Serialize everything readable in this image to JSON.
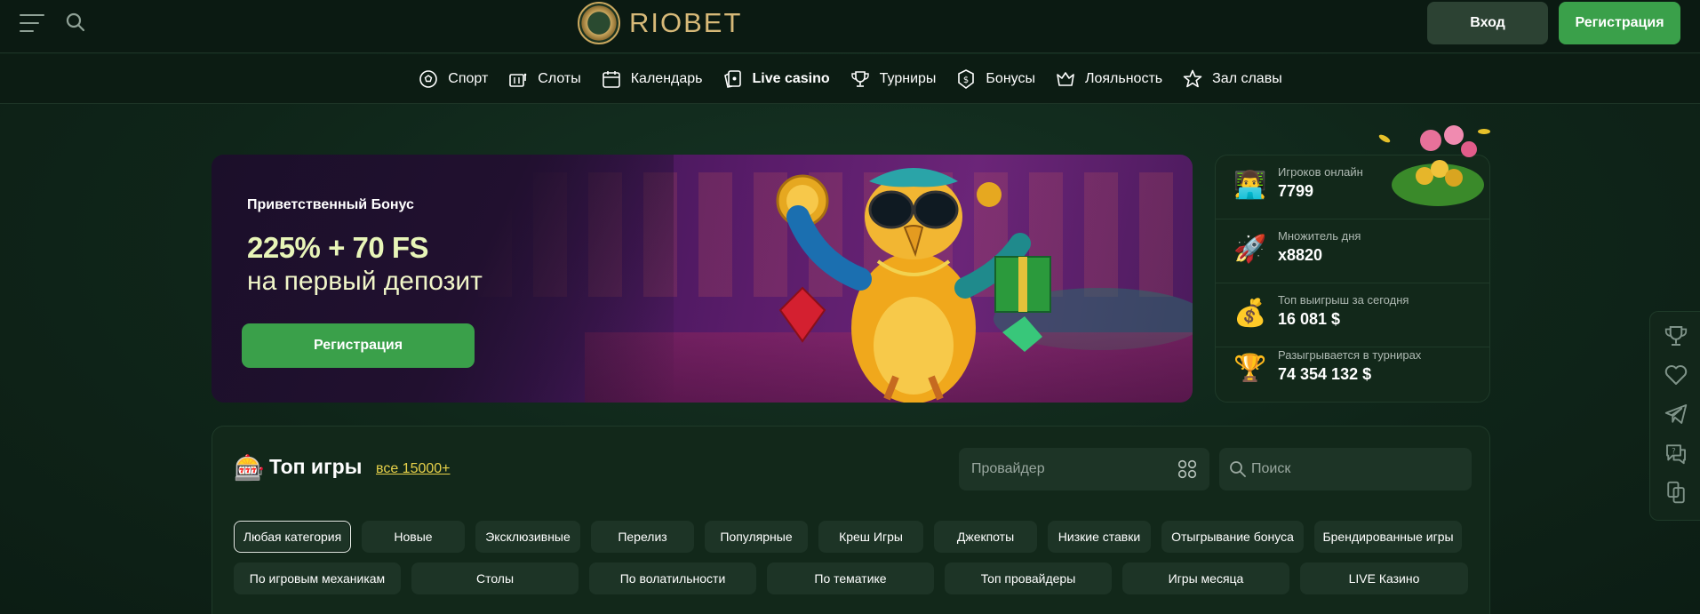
{
  "header": {
    "logo_text": "RIOBET",
    "login_label": "Вход",
    "register_label": "Регистрация"
  },
  "nav": {
    "items": [
      {
        "label": "Спорт",
        "icon": "soccer-ball-icon"
      },
      {
        "label": "Слоты",
        "icon": "slot-machine-icon"
      },
      {
        "label": "Календарь",
        "icon": "calendar-icon"
      },
      {
        "label": "Live casino",
        "icon": "cards-icon"
      },
      {
        "label": "Турниры",
        "icon": "trophy-icon"
      },
      {
        "label": "Бонусы",
        "icon": "coin-icon"
      },
      {
        "label": "Лояльность",
        "icon": "crown-icon"
      },
      {
        "label": "Зал славы",
        "icon": "star-icon"
      }
    ]
  },
  "hero": {
    "subtitle": "Приветственный Бонус",
    "title": "225% + 70 FS",
    "title2": "на первый депозит",
    "button_label": "Регистрация"
  },
  "stats": [
    {
      "label": "Игроков онлайн",
      "value": "7799",
      "icon": "player-icon"
    },
    {
      "label": "Множитель дня",
      "value": "x8820",
      "icon": "rocket-icon"
    },
    {
      "label": "Топ выигрыш за сегодня",
      "value": "16 081 $",
      "icon": "money-bag-icon"
    },
    {
      "label": "Разыгрывается в турнирах",
      "value": "74 354 132 $",
      "icon": "trophy-icon"
    }
  ],
  "side_toolbar": [
    "trophy-icon",
    "heart-icon",
    "telegram-icon",
    "support-chat-icon",
    "app-icon"
  ],
  "games": {
    "title": "Топ игры",
    "all_link": "все 15000+",
    "provider_placeholder": "Провайдер",
    "search_placeholder": "Поиск",
    "categories_row1": [
      "Любая категория",
      "Новые",
      "Эксклюзивные",
      "Перелиз",
      "Популярные",
      "Креш Игры",
      "Джекпоты",
      "Низкие ставки",
      "Отыгрывание бонуса",
      "Брендированные игры"
    ],
    "categories_row2": [
      "По игровым механикам",
      "Столы",
      "По волатильности",
      "По тематике",
      "Топ провайдеры",
      "Игры месяца",
      "LIVE Казино"
    ],
    "active_category": "Любая категория"
  },
  "colors": {
    "accent_green": "#3aa04a",
    "gold": "#d7b978",
    "link_yellow": "#e8d24a",
    "background": "#0f2117"
  }
}
